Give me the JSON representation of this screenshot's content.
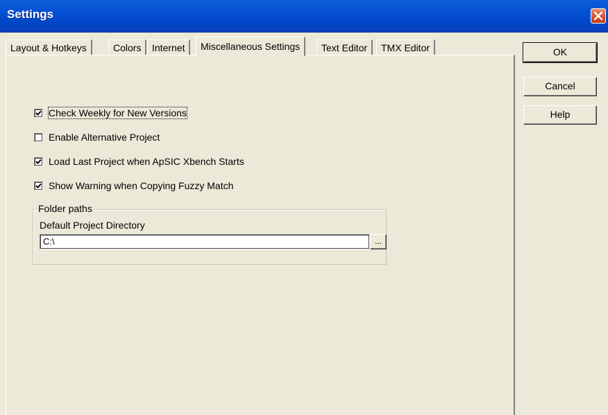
{
  "window": {
    "title": "Settings"
  },
  "tabs": [
    {
      "label": "Layout & Hotkeys",
      "active": false
    },
    {
      "label": "Colors",
      "active": false
    },
    {
      "label": "Internet",
      "active": false
    },
    {
      "label": "Miscellaneous Settings",
      "active": true
    },
    {
      "label": "Text Editor",
      "active": false
    },
    {
      "label": "TMX Editor",
      "active": false
    }
  ],
  "options": [
    {
      "label": "Check Weekly for New Versions",
      "checked": true
    },
    {
      "label": "Enable Alternative Project",
      "checked": false
    },
    {
      "label": "Load Last Project when ApSIC Xbench Starts",
      "checked": true
    },
    {
      "label": "Show Warning when Copying Fuzzy Match",
      "checked": true
    }
  ],
  "folder_paths": {
    "legend": "Folder paths",
    "dir_label": "Default Project Directory",
    "dir_value": "C:\\",
    "browse_label": "..."
  },
  "buttons": {
    "ok": "OK",
    "cancel": "Cancel",
    "help": "Help"
  }
}
